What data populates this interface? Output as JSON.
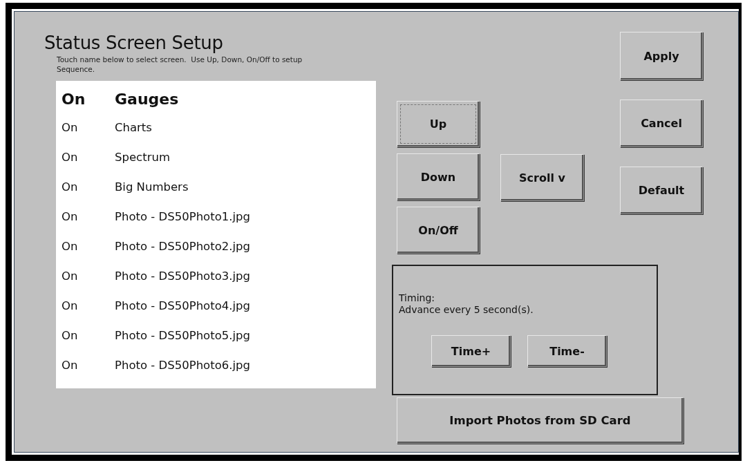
{
  "title": "Status Screen Setup",
  "instructions": "Touch name below to select screen.  Use Up, Down, On/Off to setup Sequence.",
  "screens": [
    {
      "state": "On",
      "name": "Gauges",
      "selected": true
    },
    {
      "state": "On",
      "name": "Charts",
      "selected": false
    },
    {
      "state": "On",
      "name": "Spectrum",
      "selected": false
    },
    {
      "state": "On",
      "name": "Big Numbers",
      "selected": false
    },
    {
      "state": "On",
      "name": "Photo - DS50Photo1.jpg",
      "selected": false
    },
    {
      "state": "On",
      "name": "Photo - DS50Photo2.jpg",
      "selected": false
    },
    {
      "state": "On",
      "name": "Photo - DS50Photo3.jpg",
      "selected": false
    },
    {
      "state": "On",
      "name": "Photo - DS50Photo4.jpg",
      "selected": false
    },
    {
      "state": "On",
      "name": "Photo - DS50Photo5.jpg",
      "selected": false
    },
    {
      "state": "On",
      "name": "Photo - DS50Photo6.jpg",
      "selected": false
    }
  ],
  "sequence_buttons": [
    {
      "label": "Up",
      "focused": true
    },
    {
      "label": "Down",
      "focused": false
    },
    {
      "label": "On/Off",
      "focused": false
    }
  ],
  "scroll_button": {
    "label": "Scroll v"
  },
  "dialog_buttons": [
    "Apply",
    "Cancel",
    "Default"
  ],
  "timing": {
    "label": "Timing:",
    "text": "Advance every 5 second(s).",
    "buttons": [
      "Time+",
      "Time-"
    ]
  },
  "import_button": {
    "label": "Import Photos from SD Card"
  }
}
